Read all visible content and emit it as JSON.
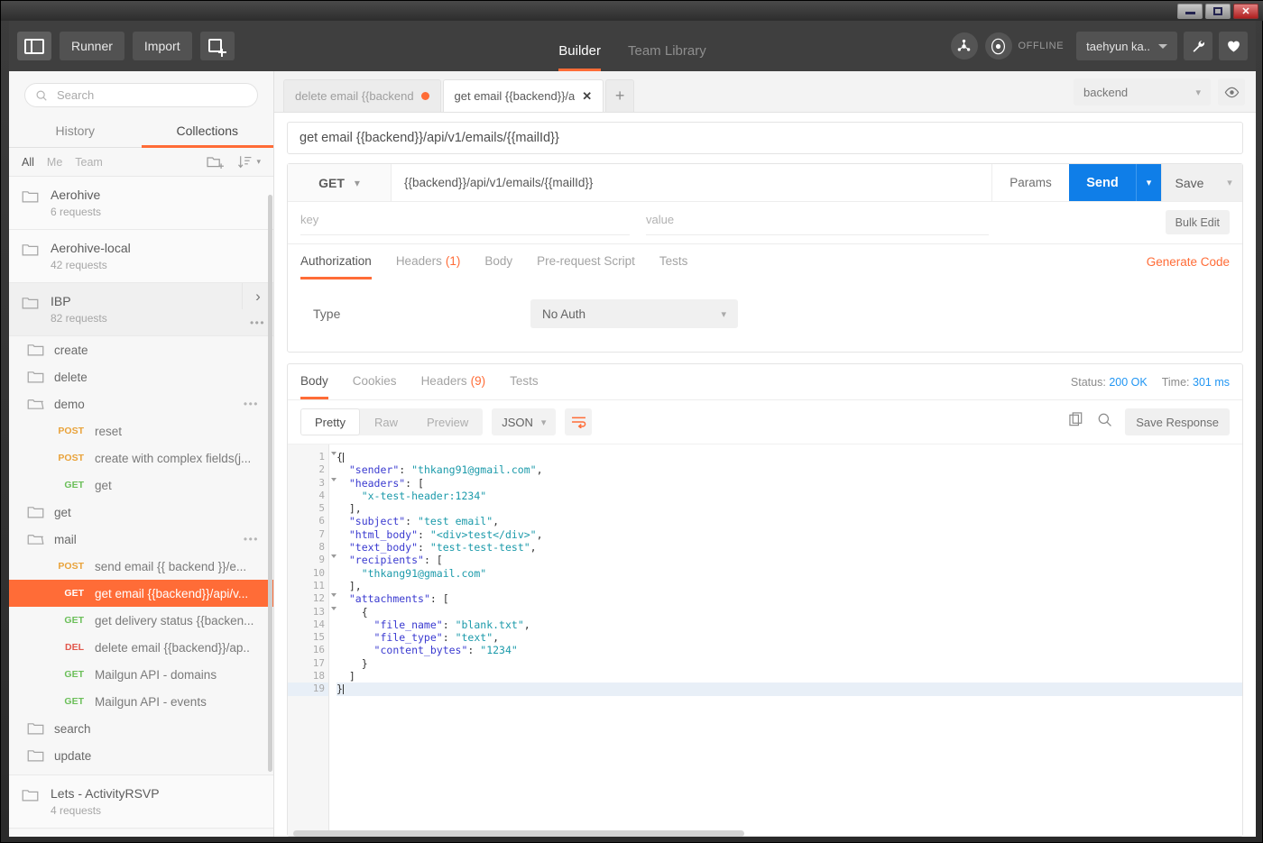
{
  "window": {
    "minimize_label": "minimize",
    "maximize_label": "maximize",
    "close_label": "✕"
  },
  "topbar": {
    "sidebar_toggle": "sidebar-toggle",
    "runner_label": "Runner",
    "import_label": "Import",
    "new_tab_label": "new-window",
    "nav": [
      {
        "label": "Builder",
        "active": true
      },
      {
        "label": "Team Library",
        "active": false
      }
    ],
    "sync_icon": "sync-icon",
    "status_icon": "status-icon",
    "status_label": "OFFLINE",
    "user_name": "taehyun ka..",
    "wrench_icon": "wrench-icon",
    "heart_icon": "heart-icon"
  },
  "sidebar": {
    "search_placeholder": "Search",
    "search_value": "",
    "tabs": [
      {
        "label": "History",
        "active": false
      },
      {
        "label": "Collections",
        "active": true
      }
    ],
    "filters": [
      {
        "label": "All",
        "active": true
      },
      {
        "label": "Me",
        "active": false
      },
      {
        "label": "Team",
        "active": false
      }
    ],
    "new_folder_icon": "new-folder-icon",
    "sort_icon": "sort-icon",
    "collections": [
      {
        "name": "Aerohive",
        "count": "6 requests"
      },
      {
        "name": "Aerohive-local",
        "count": "42 requests"
      },
      {
        "name": "IBP",
        "count": "82 requests",
        "highlight": true
      }
    ],
    "ibp_tree": [
      {
        "type": "folder",
        "name": "create",
        "open": false
      },
      {
        "type": "folder",
        "name": "delete",
        "open": false
      },
      {
        "type": "folder",
        "name": "demo",
        "open": true,
        "dots": true
      },
      {
        "type": "request",
        "method": "POST",
        "name": "reset"
      },
      {
        "type": "request",
        "method": "POST",
        "name": "create with complex fields(j..."
      },
      {
        "type": "request",
        "method": "GET",
        "name": "get"
      },
      {
        "type": "folder",
        "name": "get",
        "open": false
      },
      {
        "type": "folder",
        "name": "mail",
        "open": true,
        "dots": true
      },
      {
        "type": "request",
        "method": "POST",
        "name": "send email {{ backend }}/e..."
      },
      {
        "type": "request",
        "method": "GET",
        "name": "get email {{backend}}/api/v...",
        "selected": true
      },
      {
        "type": "request",
        "method": "GET",
        "name": "get delivery status {{backen..."
      },
      {
        "type": "request",
        "method": "DEL",
        "name": "delete email {{backend}}/ap.."
      },
      {
        "type": "request",
        "method": "GET",
        "name": "Mailgun API - domains"
      },
      {
        "type": "request",
        "method": "GET",
        "name": "Mailgun API - events"
      },
      {
        "type": "folder",
        "name": "search",
        "open": false
      },
      {
        "type": "folder",
        "name": "update",
        "open": false
      }
    ],
    "collections_after": [
      {
        "name": "Lets - ActivityRSVP",
        "count": "4 requests"
      }
    ]
  },
  "request_tabs": {
    "tabs": [
      {
        "label": "delete email {{backend",
        "active": false,
        "unsaved": true
      },
      {
        "label": "get email {{backend}}/a",
        "active": true,
        "unsaved": false
      }
    ],
    "add_tab_label": "+",
    "environment": "backend",
    "eye_icon": "eye-icon"
  },
  "request": {
    "title": "get email {{backend}}/api/v1/emails/{{mailId}}",
    "method": "GET",
    "url": "{{backend}}/api/v1/emails/{{mailId}}",
    "params_label": "Params",
    "send_label": "Send",
    "save_label": "Save",
    "key_placeholder": "key",
    "value_placeholder": "value",
    "bulk_edit_label": "Bulk Edit",
    "tabs": [
      {
        "label": "Authorization",
        "count": "",
        "active": true
      },
      {
        "label": "Headers",
        "count": "(1)",
        "active": false
      },
      {
        "label": "Body",
        "count": "",
        "active": false
      },
      {
        "label": "Pre-request Script",
        "count": "",
        "active": false
      },
      {
        "label": "Tests",
        "count": "",
        "active": false
      }
    ],
    "generate_code_label": "Generate Code",
    "auth_type_label": "Type",
    "auth_type_value": "No Auth"
  },
  "response": {
    "tabs": [
      {
        "label": "Body",
        "count": "",
        "active": true
      },
      {
        "label": "Cookies",
        "count": "",
        "active": false
      },
      {
        "label": "Headers",
        "count": "(9)",
        "active": false
      },
      {
        "label": "Tests",
        "count": "",
        "active": false
      }
    ],
    "status_label": "Status:",
    "status_value": "200 OK",
    "time_label": "Time:",
    "time_value": "301 ms",
    "formats": [
      {
        "label": "Pretty",
        "active": true
      },
      {
        "label": "Raw",
        "active": false
      },
      {
        "label": "Preview",
        "active": false
      }
    ],
    "language": "JSON",
    "wrap_icon": "wrap-lines-icon",
    "copy_icon": "copy-icon",
    "search_icon": "search-icon",
    "save_response_label": "Save Response",
    "body_lines": [
      {
        "n": 1,
        "fold": true,
        "indent": 0,
        "tokens": [
          {
            "t": "p",
            "v": "{"
          },
          {
            "t": "caret",
            "v": ""
          }
        ]
      },
      {
        "n": 2,
        "fold": false,
        "indent": 1,
        "tokens": [
          {
            "t": "k",
            "v": "\"sender\""
          },
          {
            "t": "p",
            "v": ": "
          },
          {
            "t": "s",
            "v": "\"thkang91@gmail.com\""
          },
          {
            "t": "p",
            "v": ","
          }
        ]
      },
      {
        "n": 3,
        "fold": true,
        "indent": 1,
        "tokens": [
          {
            "t": "k",
            "v": "\"headers\""
          },
          {
            "t": "p",
            "v": ": ["
          }
        ]
      },
      {
        "n": 4,
        "fold": false,
        "indent": 2,
        "tokens": [
          {
            "t": "s",
            "v": "\"x-test-header:1234\""
          }
        ]
      },
      {
        "n": 5,
        "fold": false,
        "indent": 1,
        "tokens": [
          {
            "t": "p",
            "v": "],"
          }
        ]
      },
      {
        "n": 6,
        "fold": false,
        "indent": 1,
        "tokens": [
          {
            "t": "k",
            "v": "\"subject\""
          },
          {
            "t": "p",
            "v": ": "
          },
          {
            "t": "s",
            "v": "\"test email\""
          },
          {
            "t": "p",
            "v": ","
          }
        ]
      },
      {
        "n": 7,
        "fold": false,
        "indent": 1,
        "tokens": [
          {
            "t": "k",
            "v": "\"html_body\""
          },
          {
            "t": "p",
            "v": ": "
          },
          {
            "t": "s",
            "v": "\"<div>test</div>\""
          },
          {
            "t": "p",
            "v": ","
          }
        ]
      },
      {
        "n": 8,
        "fold": false,
        "indent": 1,
        "tokens": [
          {
            "t": "k",
            "v": "\"text_body\""
          },
          {
            "t": "p",
            "v": ": "
          },
          {
            "t": "s",
            "v": "\"test-test-test\""
          },
          {
            "t": "p",
            "v": ","
          }
        ]
      },
      {
        "n": 9,
        "fold": true,
        "indent": 1,
        "tokens": [
          {
            "t": "k",
            "v": "\"recipients\""
          },
          {
            "t": "p",
            "v": ": ["
          }
        ]
      },
      {
        "n": 10,
        "fold": false,
        "indent": 2,
        "tokens": [
          {
            "t": "s",
            "v": "\"thkang91@gmail.com\""
          }
        ]
      },
      {
        "n": 11,
        "fold": false,
        "indent": 1,
        "tokens": [
          {
            "t": "p",
            "v": "],"
          }
        ]
      },
      {
        "n": 12,
        "fold": true,
        "indent": 1,
        "tokens": [
          {
            "t": "k",
            "v": "\"attachments\""
          },
          {
            "t": "p",
            "v": ": ["
          }
        ]
      },
      {
        "n": 13,
        "fold": true,
        "indent": 2,
        "tokens": [
          {
            "t": "p",
            "v": "{"
          }
        ]
      },
      {
        "n": 14,
        "fold": false,
        "indent": 3,
        "tokens": [
          {
            "t": "k",
            "v": "\"file_name\""
          },
          {
            "t": "p",
            "v": ": "
          },
          {
            "t": "s",
            "v": "\"blank.txt\""
          },
          {
            "t": "p",
            "v": ","
          }
        ]
      },
      {
        "n": 15,
        "fold": false,
        "indent": 3,
        "tokens": [
          {
            "t": "k",
            "v": "\"file_type\""
          },
          {
            "t": "p",
            "v": ": "
          },
          {
            "t": "s",
            "v": "\"text\""
          },
          {
            "t": "p",
            "v": ","
          }
        ]
      },
      {
        "n": 16,
        "fold": false,
        "indent": 3,
        "tokens": [
          {
            "t": "k",
            "v": "\"content_bytes\""
          },
          {
            "t": "p",
            "v": ": "
          },
          {
            "t": "s",
            "v": "\"1234\""
          }
        ]
      },
      {
        "n": 17,
        "fold": false,
        "indent": 2,
        "tokens": [
          {
            "t": "p",
            "v": "}"
          }
        ]
      },
      {
        "n": 18,
        "fold": false,
        "indent": 1,
        "tokens": [
          {
            "t": "p",
            "v": "]"
          }
        ]
      },
      {
        "n": 19,
        "fold": false,
        "indent": 0,
        "current": true,
        "tokens": [
          {
            "t": "p",
            "v": "}"
          },
          {
            "t": "caret",
            "v": ""
          }
        ]
      }
    ]
  },
  "colors": {
    "accent": "#ff6c37",
    "send_blue": "#0f7ee8",
    "method_get": "#6bbf59",
    "method_post": "#e9a33b",
    "method_delete": "#e2574c",
    "status_blue": "#2196f3",
    "topbar_bg": "#3f3f3f",
    "sidebar_bg": "#f7f7f7"
  }
}
